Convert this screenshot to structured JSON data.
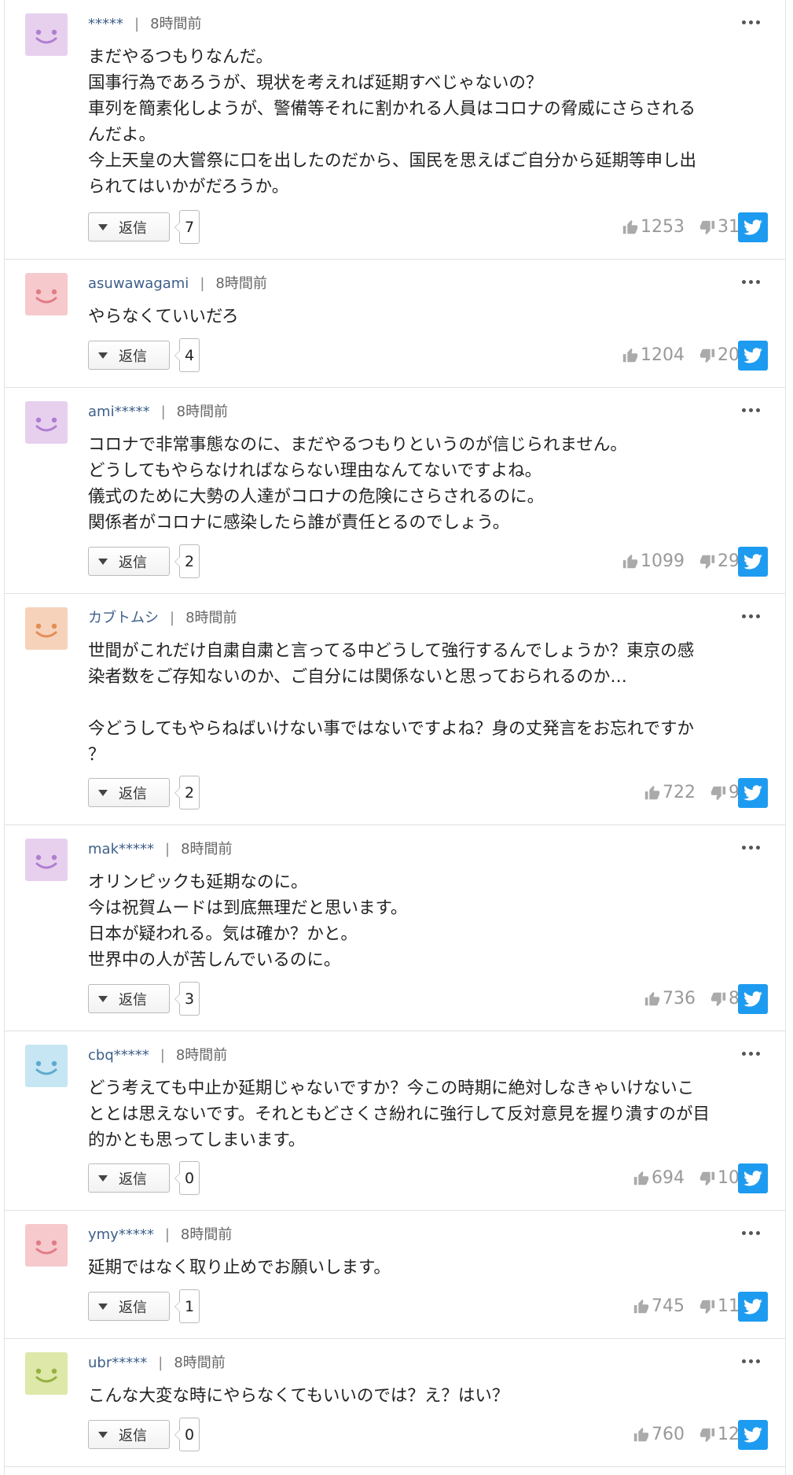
{
  "labels": {
    "reply": "返信"
  },
  "comments": [
    {
      "user": "*****",
      "time": "8時間前",
      "avatar_color": "#e7d0ee",
      "face_color": "#b07ed0",
      "lines": [
        "まだやるつもりなんだ。",
        "国事行為であろうが、現状を考えれば延期すべじゃないの？",
        "車列を簡素化しようが、警備等それに割かれる人員はコロナの脅威にさらされる",
        "んだよ。",
        "今上天皇の大嘗祭に口を出したのだから、国民を思えばご自分から延期等申し出",
        "られてはいかがだろうか。"
      ],
      "replies": "7",
      "likes": "1253",
      "dislikes": "31"
    },
    {
      "user": "asuwawagami",
      "time": "8時間前",
      "avatar_color": "#f6c9cd",
      "face_color": "#e07d86",
      "lines": [
        "やらなくていいだろ"
      ],
      "replies": "4",
      "likes": "1204",
      "dislikes": "20"
    },
    {
      "user": "ami*****",
      "time": "8時間前",
      "avatar_color": "#e7d0ee",
      "face_color": "#b07ed0",
      "lines": [
        "コロナで非常事態なのに、まだやるつもりというのが信じられません。",
        "どうしてもやらなければならない理由なんてないですよね。",
        "儀式のために大勢の人達がコロナの危険にさらされるのに。",
        "関係者がコロナに感染したら誰が責任とるのでしょう。"
      ],
      "replies": "2",
      "likes": "1099",
      "dislikes": "29"
    },
    {
      "user": "カブトムシ",
      "time": "8時間前",
      "avatar_color": "#f6d2bb",
      "face_color": "#e38d55",
      "lines": [
        "世間がこれだけ自粛自粛と言ってる中どうして強行するんでしょうか？東京の感",
        "染者数をご存知ないのか、ご自分には関係ないと思っておられるのか…",
        "",
        "今どうしてもやらねばいけない事ではないですよね？身の丈発言をお忘れですか",
        "？"
      ],
      "replies": "2",
      "likes": "722",
      "dislikes": "9"
    },
    {
      "user": "mak*****",
      "time": "8時間前",
      "avatar_color": "#e7d0ee",
      "face_color": "#b07ed0",
      "lines": [
        "オリンピックも延期なのに。",
        "今は祝賀ムードは到底無理だと思います。",
        "日本が疑われる。気は確か？かと。",
        "世界中の人が苦しんでいるのに。"
      ],
      "replies": "3",
      "likes": "736",
      "dislikes": "8"
    },
    {
      "user": "cbq*****",
      "time": "8時間前",
      "avatar_color": "#c6e6f3",
      "face_color": "#5fa9cf",
      "lines": [
        "どう考えても中止か延期じゃないですか？今この時期に絶対しなきゃいけないこ",
        "ととは思えないです。それともどさくさ紛れに強行して反対意見を握り潰すのが目",
        "的かとも思ってしまいます。"
      ],
      "replies": "0",
      "likes": "694",
      "dislikes": "10"
    },
    {
      "user": "ymy*****",
      "time": "8時間前",
      "avatar_color": "#f6c9cd",
      "face_color": "#e07d86",
      "lines": [
        "延期ではなく取り止めでお願いします。"
      ],
      "replies": "1",
      "likes": "745",
      "dislikes": "11"
    },
    {
      "user": "ubr*****",
      "time": "8時間前",
      "avatar_color": "#dde8a9",
      "face_color": "#95b03e",
      "lines": [
        "こんな大変な時にやらなくてもいいのでは？え？はい？"
      ],
      "replies": "0",
      "likes": "760",
      "dislikes": "12"
    }
  ]
}
